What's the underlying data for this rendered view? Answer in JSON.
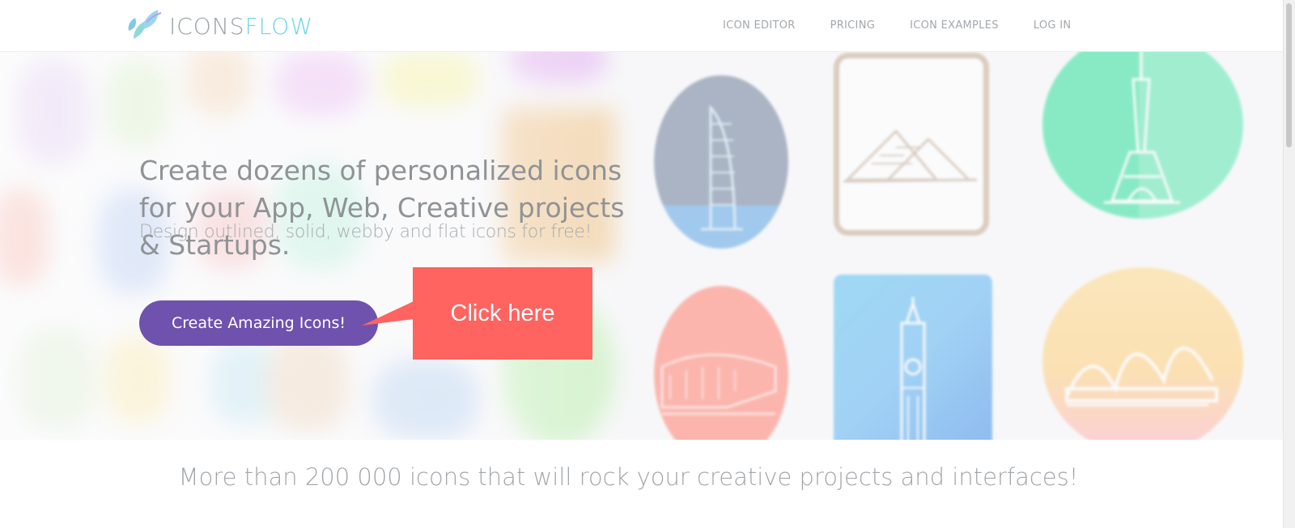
{
  "header": {
    "logo": {
      "text_main": "ICONS",
      "text_accent": "FLOW",
      "icon": "leaf-logo-icon"
    },
    "nav": [
      {
        "label": "ICON EDITOR"
      },
      {
        "label": "PRICING"
      },
      {
        "label": "ICON EXAMPLES"
      },
      {
        "label": "LOG IN"
      }
    ]
  },
  "hero": {
    "headline": "Create dozens of personalized icons for your App, Web, Creative projects & Startups.",
    "subheadline": "Design outlined, solid, webby and flat icons for free!",
    "cta_label": "Create Amazing Icons!",
    "callout_label": "Click here",
    "sample_icons": [
      "burj-al-arab-icon",
      "pyramids-icon",
      "eiffel-tower-icon",
      "colosseum-icon",
      "big-ben-icon",
      "sydney-opera-icon"
    ]
  },
  "tagline": "More than 200 000 icons that will rock your creative projects and interfaces!",
  "colors": {
    "cta": "#6f52ad",
    "callout": "#ff6460",
    "logo_accent": "#6ad6e6",
    "text": "#8f9396"
  }
}
